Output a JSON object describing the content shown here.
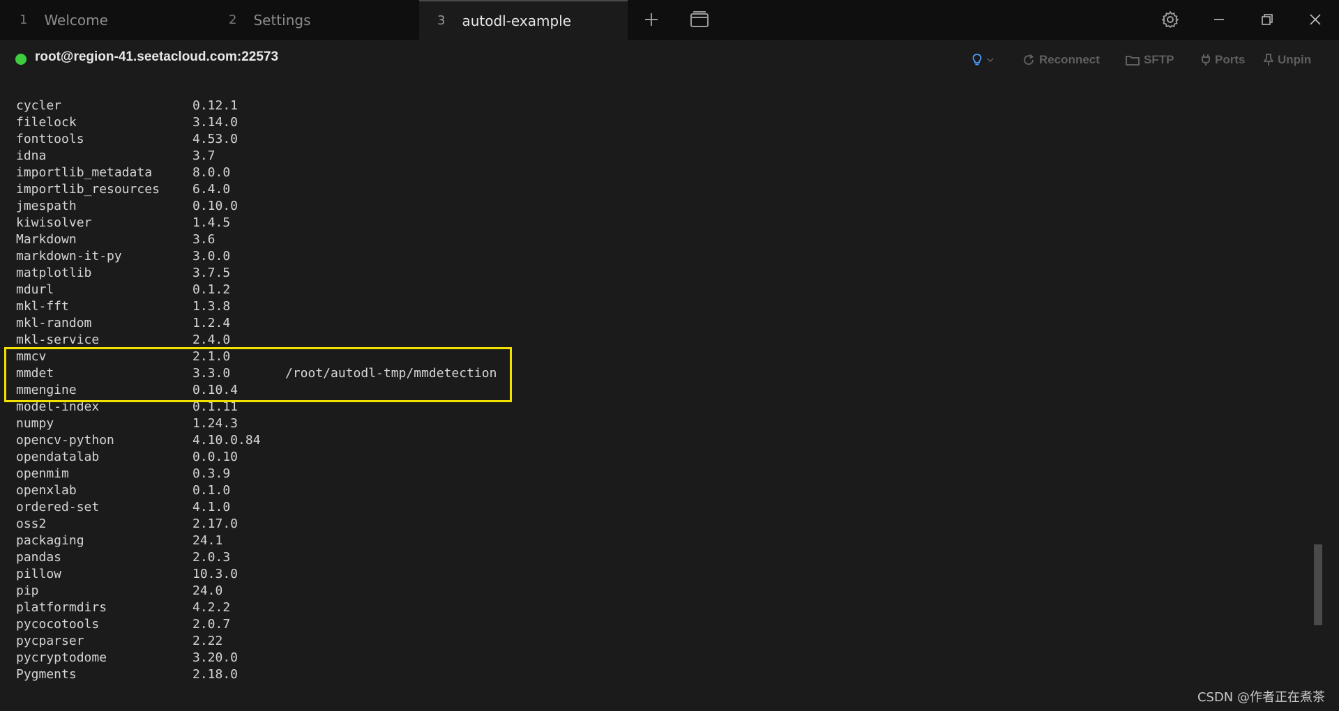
{
  "tabs": [
    {
      "num": "1",
      "label": "Welcome"
    },
    {
      "num": "2",
      "label": "Settings"
    },
    {
      "num": "3",
      "label": "autodl-example"
    }
  ],
  "header": {
    "host": "root@region-41.seetacloud.com:22573",
    "reconnect": "Reconnect",
    "sftp": "SFTP",
    "ports": "Ports",
    "unpin": "Unpin"
  },
  "packages": [
    {
      "name": "cycler",
      "version": "0.12.1",
      "location": ""
    },
    {
      "name": "filelock",
      "version": "3.14.0",
      "location": ""
    },
    {
      "name": "fonttools",
      "version": "4.53.0",
      "location": ""
    },
    {
      "name": "idna",
      "version": "3.7",
      "location": ""
    },
    {
      "name": "importlib_metadata",
      "version": "8.0.0",
      "location": ""
    },
    {
      "name": "importlib_resources",
      "version": "6.4.0",
      "location": ""
    },
    {
      "name": "jmespath",
      "version": "0.10.0",
      "location": ""
    },
    {
      "name": "kiwisolver",
      "version": "1.4.5",
      "location": ""
    },
    {
      "name": "Markdown",
      "version": "3.6",
      "location": ""
    },
    {
      "name": "markdown-it-py",
      "version": "3.0.0",
      "location": ""
    },
    {
      "name": "matplotlib",
      "version": "3.7.5",
      "location": ""
    },
    {
      "name": "mdurl",
      "version": "0.1.2",
      "location": ""
    },
    {
      "name": "mkl-fft",
      "version": "1.3.8",
      "location": ""
    },
    {
      "name": "mkl-random",
      "version": "1.2.4",
      "location": ""
    },
    {
      "name": "mkl-service",
      "version": "2.4.0",
      "location": ""
    },
    {
      "name": "mmcv",
      "version": "2.1.0",
      "location": ""
    },
    {
      "name": "mmdet",
      "version": "3.3.0",
      "location": "/root/autodl-tmp/mmdetection"
    },
    {
      "name": "mmengine",
      "version": "0.10.4",
      "location": ""
    },
    {
      "name": "model-index",
      "version": "0.1.11",
      "location": ""
    },
    {
      "name": "numpy",
      "version": "1.24.3",
      "location": ""
    },
    {
      "name": "opencv-python",
      "version": "4.10.0.84",
      "location": ""
    },
    {
      "name": "opendatalab",
      "version": "0.0.10",
      "location": ""
    },
    {
      "name": "openmim",
      "version": "0.3.9",
      "location": ""
    },
    {
      "name": "openxlab",
      "version": "0.1.0",
      "location": ""
    },
    {
      "name": "ordered-set",
      "version": "4.1.0",
      "location": ""
    },
    {
      "name": "oss2",
      "version": "2.17.0",
      "location": ""
    },
    {
      "name": "packaging",
      "version": "24.1",
      "location": ""
    },
    {
      "name": "pandas",
      "version": "2.0.3",
      "location": ""
    },
    {
      "name": "pillow",
      "version": "10.3.0",
      "location": ""
    },
    {
      "name": "pip",
      "version": "24.0",
      "location": ""
    },
    {
      "name": "platformdirs",
      "version": "4.2.2",
      "location": ""
    },
    {
      "name": "pycocotools",
      "version": "2.0.7",
      "location": ""
    },
    {
      "name": "pycparser",
      "version": "2.22",
      "location": ""
    },
    {
      "name": "pycryptodome",
      "version": "3.20.0",
      "location": ""
    },
    {
      "name": "Pygments",
      "version": "2.18.0",
      "location": ""
    }
  ],
  "watermark": "CSDN @作者正在煮茶",
  "colors": {
    "status_dot": "#3fcc3f",
    "highlight_box": "#f2e100",
    "bulb": "#4a9cff"
  }
}
